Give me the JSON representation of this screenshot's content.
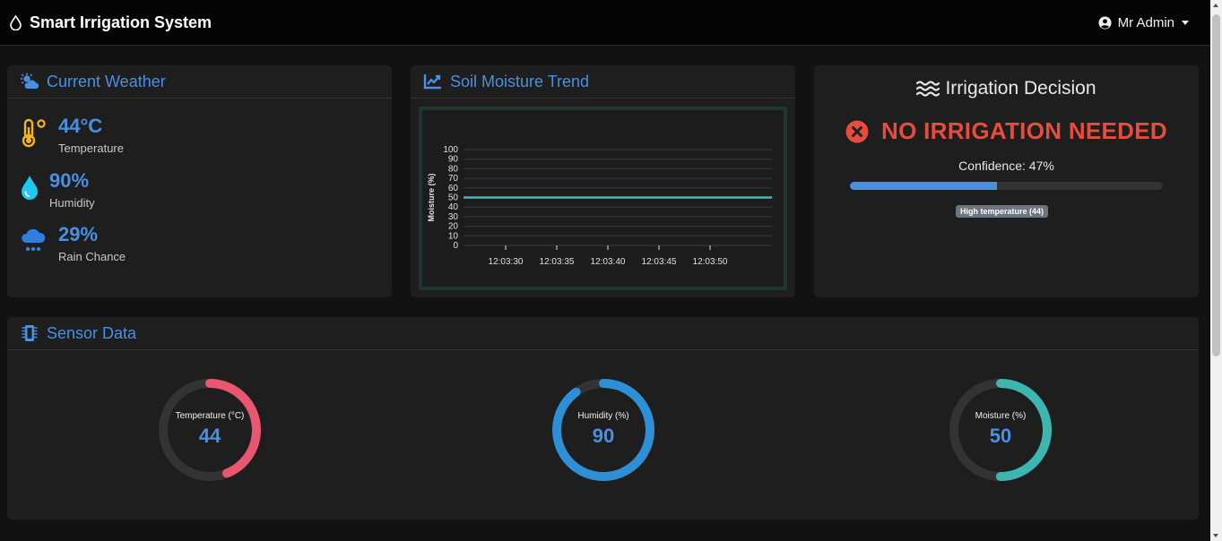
{
  "app": {
    "title": "Smart Irrigation System"
  },
  "user": {
    "name": "Mr Admin"
  },
  "weather": {
    "title": "Current Weather",
    "items": [
      {
        "value": "44°C",
        "label": "Temperature",
        "icon": "thermometer-icon",
        "color": "#f5b41e"
      },
      {
        "value": "90%",
        "label": "Humidity",
        "icon": "water-drop-icon",
        "color": "#1ec8f0"
      },
      {
        "value": "29%",
        "label": "Rain Chance",
        "icon": "cloud-rain-icon",
        "color": "#2f7fe0"
      }
    ]
  },
  "trend": {
    "title": "Soil Moisture Trend",
    "chart_data": {
      "type": "line",
      "ylabel": "Moisture (%)",
      "ylim": [
        0,
        100
      ],
      "yticks": [
        0,
        10,
        20,
        30,
        40,
        50,
        60,
        70,
        80,
        90,
        100
      ],
      "xticks": [
        "12:03:30",
        "12:03:35",
        "12:03:40",
        "12:03:45",
        "12:03:50"
      ],
      "series": [
        {
          "values": [
            50,
            50,
            50,
            50,
            50,
            50,
            50,
            50
          ],
          "color": "#3cbfb3"
        }
      ]
    }
  },
  "decision": {
    "title": "Irrigation Decision",
    "status": "NO IRRIGATION NEEDED",
    "confidence_text": "Confidence: 47%",
    "confidence": 47,
    "reason": "High temperature (44)",
    "status_color": "#e74c3c"
  },
  "sensors": {
    "title": "Sensor Data",
    "gauges": [
      {
        "label": "Temperature (°C)",
        "value": "44",
        "fraction": 0.44,
        "color": "#e8566f"
      },
      {
        "label": "Humidity (%)",
        "value": "90",
        "fraction": 0.9,
        "color": "#2d8fd6"
      },
      {
        "label": "Moisture (%)",
        "value": "50",
        "fraction": 0.5,
        "color": "#3cb6b0"
      }
    ]
  }
}
